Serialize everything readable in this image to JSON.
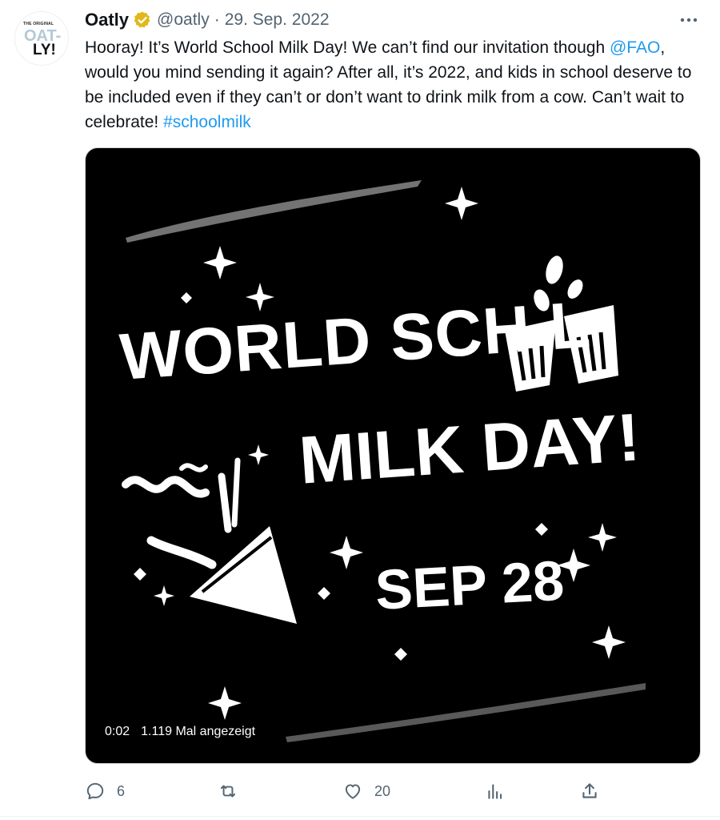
{
  "tweet": {
    "author_name": "Oatly",
    "handle": "@oatly",
    "separator": "·",
    "date": "29. Sep. 2022",
    "avatar_text": {
      "tag": "THE ORIGINAL",
      "line1": "OAT-",
      "line2": "LY!"
    },
    "text": {
      "part1": "Hooray! It’s World School Milk Day! We can’t find our invitation though ",
      "mention": "@FAO",
      "part2": ", would you mind sending it again? After all, it’s 2022, and kids in school deserve to be included even if they can’t or don’t want to drink milk from a cow. Can’t wait to celebrate! ",
      "hashtag": "#schoolmilk"
    }
  },
  "media": {
    "line1": "WORLD SCH   L",
    "line2": "MILK DAY!",
    "line3": "SEP 28",
    "time": "0:02",
    "views_label": "1.119 Mal angezeigt"
  },
  "actions": {
    "reply_count": "6",
    "retweet_count": "",
    "like_count": "20"
  },
  "icons": {
    "verified": "verified-badge-icon",
    "more": "more-icon",
    "reply": "reply-icon",
    "retweet": "retweet-icon",
    "like": "like-icon",
    "views": "views-icon",
    "share": "share-icon"
  },
  "colors": {
    "link": "#1d9bf0",
    "secondary_text": "#536471",
    "verified_gold": "#e2b719",
    "media_bg": "#000000"
  }
}
